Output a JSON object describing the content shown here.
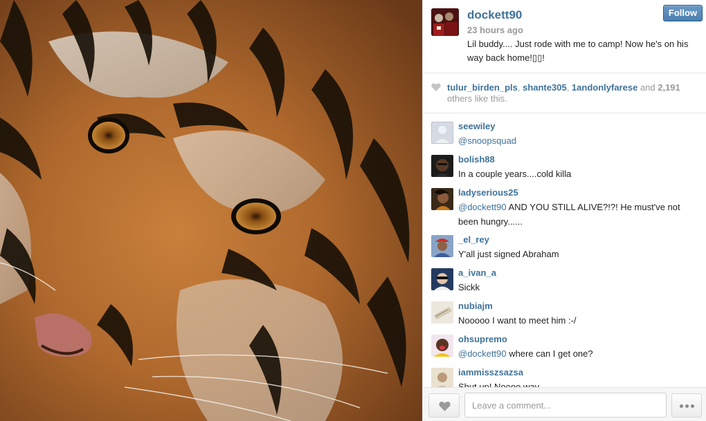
{
  "post": {
    "owner": "dockett90",
    "time": "23 hours ago",
    "caption": "Lil buddy.... Just rode with me to camp! Now he's on his way back home!▯▯!",
    "follow_label": "Follow"
  },
  "likes": {
    "users": [
      "tulur_birden_pls",
      "shante305",
      "1andonlyfarese"
    ],
    "sep1": ", ",
    "sep2": ", ",
    "and_word": " and ",
    "count": "2,191",
    "tail": "others like this."
  },
  "comments": [
    {
      "user": "seewiley",
      "mention": "@snoopsquad",
      "text": ""
    },
    {
      "user": "bolish88",
      "mention": "",
      "text": "In a couple years....cold killa"
    },
    {
      "user": "ladyserious25",
      "mention": "@dockett90",
      "text": " AND YOU STILL ALIVE?!?! He must've not been hungry......"
    },
    {
      "user": "_el_rey",
      "mention": "",
      "text": "Y'all just signed Abraham"
    },
    {
      "user": "a_ivan_a",
      "mention": "",
      "text": "Sickk"
    },
    {
      "user": "nubiajm",
      "mention": "",
      "text": "Nooooo I want to meet him :-/"
    },
    {
      "user": "ohsupremo",
      "mention": "@dockett90",
      "text": " where can I get one?"
    },
    {
      "user": "iammisszsazsa",
      "mention": "",
      "text": "Shut up! Noooo way"
    }
  ],
  "footer": {
    "placeholder": "Leave a comment..."
  },
  "icons": {
    "heart": "heart-icon",
    "more": "more-dots-icon"
  },
  "colors": {
    "link": "#3f729b",
    "follow_bg": "#517fa4"
  }
}
